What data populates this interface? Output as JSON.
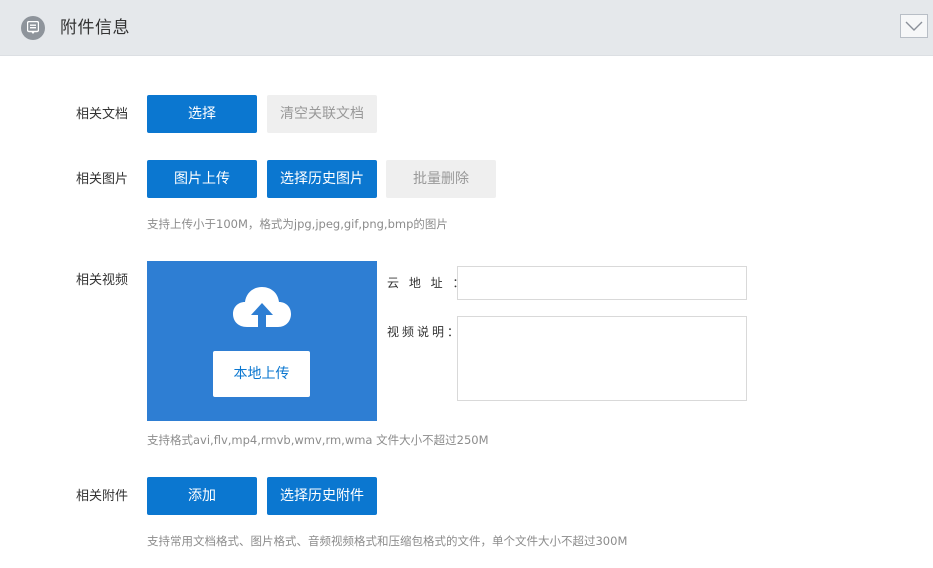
{
  "header": {
    "title": "附件信息",
    "icon": "attachment-icon",
    "collapse_icon": "chevron-down-icon"
  },
  "documents": {
    "label": "相关文档",
    "select_label": "选择",
    "clear_label": "清空关联文档"
  },
  "images": {
    "label": "相关图片",
    "upload_label": "图片上传",
    "history_label": "选择历史图片",
    "batch_delete_label": "批量删除",
    "hint": "支持上传小于100M，格式为jpg,jpeg,gif,png,bmp的图片"
  },
  "video": {
    "label": "相关视频",
    "local_upload_label": "本地上传",
    "cloud_address_label": "云 地 址 ：",
    "cloud_address_value": "",
    "description_label": "视频说明：",
    "description_value": "",
    "hint": "支持格式avi,flv,mp4,rmvb,wmv,rm,wma 文件大小不超过250M"
  },
  "attachments": {
    "label": "相关附件",
    "add_label": "添加",
    "history_label": "选择历史附件",
    "hint": "支持常用文档格式、图片格式、音频视频格式和压缩包格式的文件，单个文件大小不超过300M"
  },
  "colors": {
    "primary": "#0b77d0",
    "upload_box": "#2e7ed3",
    "disabled_bg": "#efefef",
    "header_bg": "#e5e8eb"
  }
}
